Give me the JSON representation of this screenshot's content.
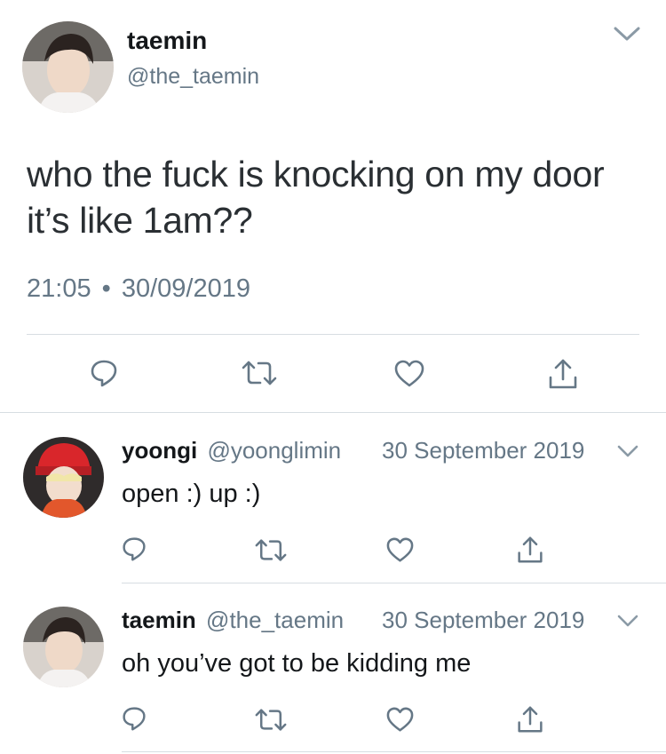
{
  "main_tweet": {
    "author_name": "taemin",
    "author_handle": "@the_taemin",
    "text_line1": "who the fuck is knocking on my door",
    "text_line2": "it’s like 1am??",
    "time": "21:05",
    "separator": "•",
    "date": "30/09/2019"
  },
  "replies": [
    {
      "author_name": "yoongi",
      "author_handle": "@yoonglimin",
      "date": "30 September 2019",
      "text": "open :) up :)"
    },
    {
      "author_name": "taemin",
      "author_handle": "@the_taemin",
      "date": "30 September 2019",
      "text": "oh you’ve got to be kidding me"
    }
  ],
  "icons": {
    "reply": "reply-icon",
    "retweet": "retweet-icon",
    "like": "heart-icon",
    "share": "share-icon",
    "more": "chevron-down-icon"
  },
  "colors": {
    "text": "#14171a",
    "muted": "#657786",
    "divider": "#d7dde2"
  }
}
